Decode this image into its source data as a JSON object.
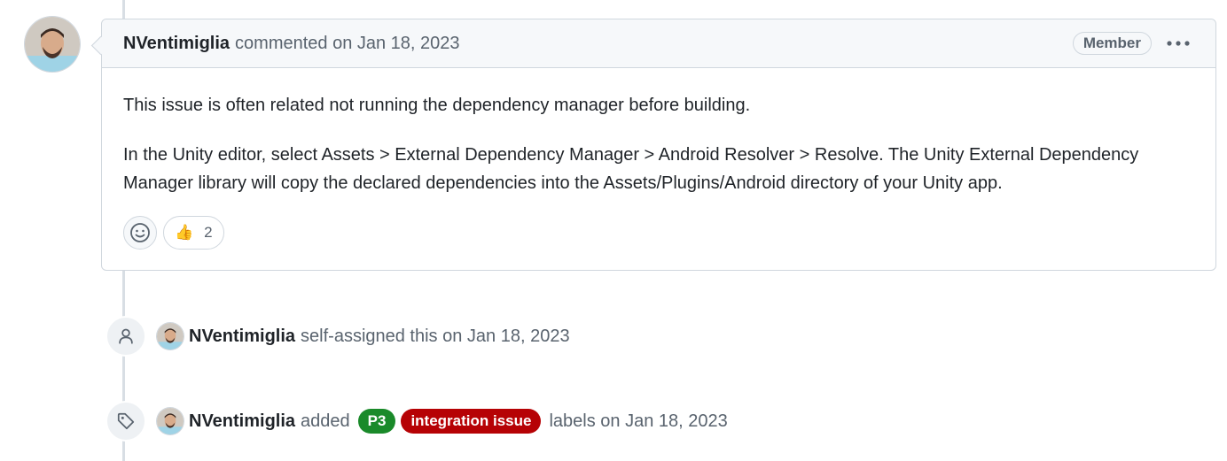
{
  "comment": {
    "author": "NVentimiglia",
    "action": "commented on Jan 18, 2023",
    "badge": "Member",
    "paragraphs": [
      "This issue is often related not running the dependency manager before building.",
      "In the Unity editor, select Assets > External Dependency Manager > Android Resolver > Resolve. The Unity External Dependency Manager library will copy the declared dependencies into the Assets/Plugins/Android directory of your Unity app."
    ],
    "reactions": [
      {
        "emoji": "👍",
        "count": "2"
      }
    ]
  },
  "events": [
    {
      "icon": "person-icon",
      "author": "NVentimiglia",
      "text": "self-assigned this on Jan 18, 2023"
    },
    {
      "icon": "tag-icon",
      "author": "NVentimiglia",
      "prefix": "added",
      "labels": [
        {
          "name": "P3",
          "color": "#1a8a2a"
        },
        {
          "name": "integration issue",
          "color": "#b60205"
        }
      ],
      "suffix": "labels on Jan 18, 2023"
    }
  ],
  "colors": {
    "timeline": "#d8dee4",
    "muted_text": "#59636e",
    "label_p3": "#1a8a2a",
    "label_integration": "#b60205"
  }
}
